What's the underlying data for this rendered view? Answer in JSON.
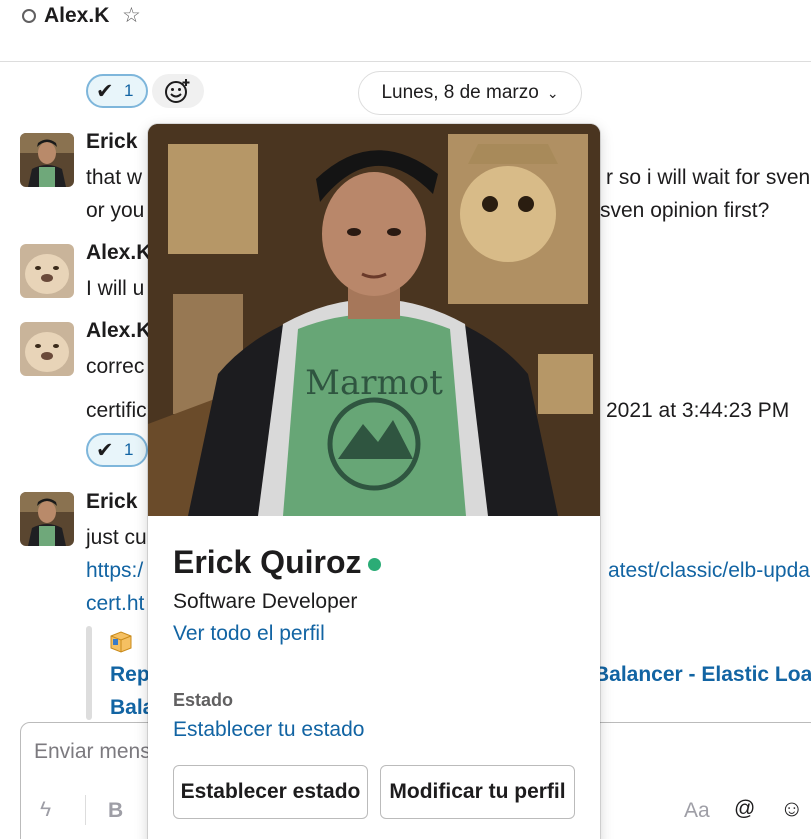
{
  "header": {
    "name": "Alex.K",
    "star_icon": "star-outline-icon"
  },
  "reactions": [
    {
      "emoji": "✔",
      "count": "1"
    },
    {
      "emoji": "✔",
      "count": "1"
    }
  ],
  "date_divider": {
    "label": "Lunes, 8 de marzo",
    "chevron": "⌄"
  },
  "messages": [
    {
      "sender": "Erick",
      "lines": [
        "that w",
        "r so i will wait for sven",
        "or you",
        "sven opinion first?"
      ]
    },
    {
      "sender": "Alex.K",
      "lines": [
        "I will u"
      ]
    },
    {
      "sender": "Alex.K",
      "lines": [
        "correc",
        "certific",
        "2021 at 3:44:23 PM"
      ]
    },
    {
      "sender": "Erick",
      "lines": [
        "just cu",
        "https:/",
        "atest/classic/elb-upda",
        "cert.ht"
      ]
    }
  ],
  "unfurl": {
    "title_left_1": "Rep",
    "title_right": "Balancer - Elastic Load",
    "title_left_2": "Bala"
  },
  "composer": {
    "placeholder": "Enviar mens",
    "tools": {
      "shortcuts": "ϟ",
      "bold": "B",
      "format": "Aa",
      "mention": "@",
      "emoji": "☺"
    }
  },
  "profile_popover": {
    "name": "Erick Quiroz",
    "presence_color": "#2bac76",
    "title": "Software Developer",
    "view_profile": "Ver todo el perfil",
    "status_label": "Estado",
    "set_status_link": "Establecer tu estado",
    "set_status_button": "Establecer estado",
    "edit_profile_button": "Modificar tu perfil",
    "shirt_text": "Marmot"
  },
  "colors": {
    "link": "#1264a3",
    "presence": "#2bac76",
    "reaction_border": "#7eb6db",
    "reaction_bg": "#e8f5fa"
  }
}
